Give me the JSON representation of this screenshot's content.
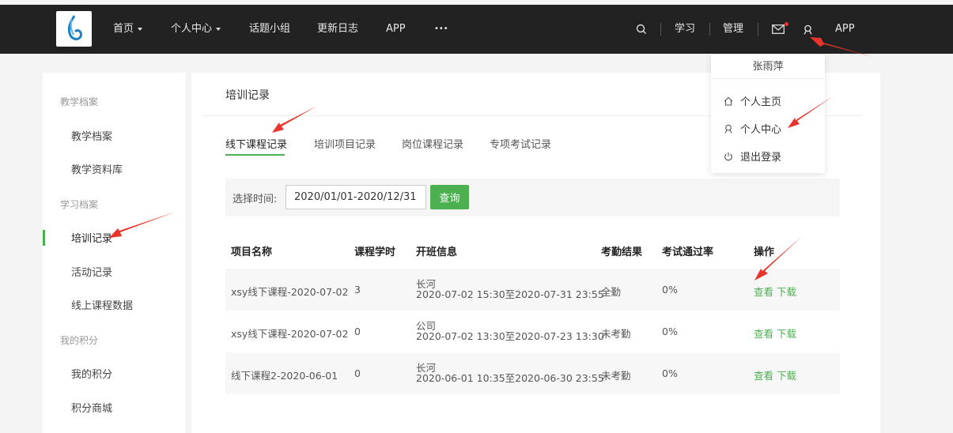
{
  "nav": {
    "items": [
      {
        "label": "首页",
        "caret": true
      },
      {
        "label": "个人中心",
        "caret": true
      },
      {
        "label": "话题小组",
        "caret": false
      },
      {
        "label": "更新日志",
        "caret": false
      },
      {
        "label": "APP",
        "caret": false
      },
      {
        "label": "•••",
        "caret": false
      }
    ],
    "right": {
      "study": "学习",
      "manage": "管理",
      "app": "APP"
    }
  },
  "dropdown": {
    "username": "张雨萍",
    "items": [
      "个人主页",
      "个人中心",
      "退出登录"
    ]
  },
  "sidebar": {
    "groups": [
      {
        "title": "教学档案",
        "items": [
          "教学档案",
          "教学资料库"
        ]
      },
      {
        "title": "学习档案",
        "items": [
          "培训记录",
          "活动记录",
          "线上课程数据"
        ]
      },
      {
        "title": "我的积分",
        "items": [
          "我的积分",
          "积分商城"
        ]
      }
    ]
  },
  "main": {
    "title": "培训记录",
    "tabs": [
      "线下课程记录",
      "培训项目记录",
      "岗位课程记录",
      "专项考试记录"
    ],
    "filter": {
      "label": "选择时间:",
      "value": "2020/01/01-2020/12/31",
      "button": "查询"
    },
    "table": {
      "headers": [
        "项目名称",
        "课程学时",
        "开班信息",
        "考勤结果",
        "考试通过率",
        "操作"
      ],
      "rows": [
        {
          "name": "xsy线下课程-2020-07-02",
          "hours": "3",
          "place": "长河",
          "time": "2020-07-02 15:30至2020-07-31 23:55",
          "attendance": "全勤",
          "rate": "0%",
          "view": "查看",
          "download": "下载"
        },
        {
          "name": "xsy线下课程-2020-07-02",
          "hours": "0",
          "place": "公司",
          "time": "2020-07-02 13:30至2020-07-23 13:30",
          "attendance": "未考勤",
          "rate": "0%",
          "view": "查看",
          "download": "下载"
        },
        {
          "name": "线下课程2-2020-06-01",
          "hours": "0",
          "place": "长河",
          "time": "2020-06-01 10:35至2020-06-30 23:55",
          "attendance": "未考勤",
          "rate": "0%",
          "view": "查看",
          "download": "下载"
        }
      ]
    }
  },
  "colors": {
    "accent": "#4caf50",
    "nav_bg": "#222222",
    "annotation": "#e8342a"
  }
}
